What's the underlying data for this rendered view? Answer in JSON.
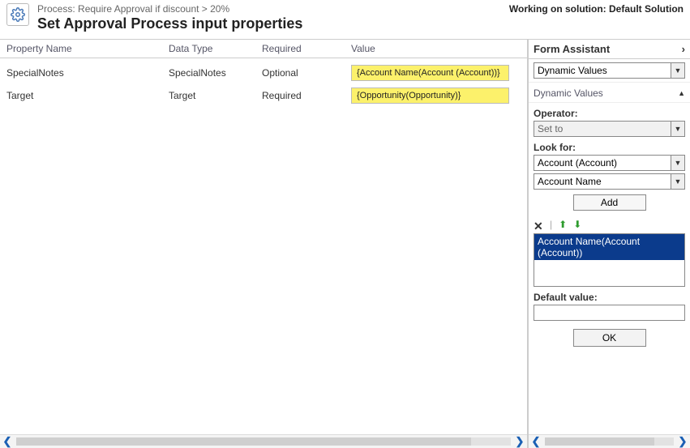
{
  "header": {
    "process_label": "Process:",
    "process_name": "Require Approval if discount > 20%",
    "title": "Set Approval Process input properties",
    "working_on_label": "Working on solution:",
    "solution_name": "Default Solution"
  },
  "columns": {
    "property_name": "Property Name",
    "data_type": "Data Type",
    "required": "Required",
    "value": "Value"
  },
  "rows": [
    {
      "name": "SpecialNotes",
      "type": "SpecialNotes",
      "required": "Optional",
      "value": "{Account Name(Account (Account))}"
    },
    {
      "name": "Target",
      "type": "Target",
      "required": "Required",
      "value": "{Opportunity(Opportunity)}"
    }
  ],
  "form_assistant": {
    "header": "Form Assistant",
    "top_dropdown": "Dynamic Values",
    "section_label": "Dynamic Values",
    "operator_label": "Operator:",
    "operator_value": "Set to",
    "lookfor_label": "Look for:",
    "lookfor_entity": "Account (Account)",
    "lookfor_field": "Account Name",
    "add_button": "Add",
    "list_item": "Account Name(Account (Account))",
    "default_label": "Default value:",
    "default_value": "",
    "ok_button": "OK"
  }
}
